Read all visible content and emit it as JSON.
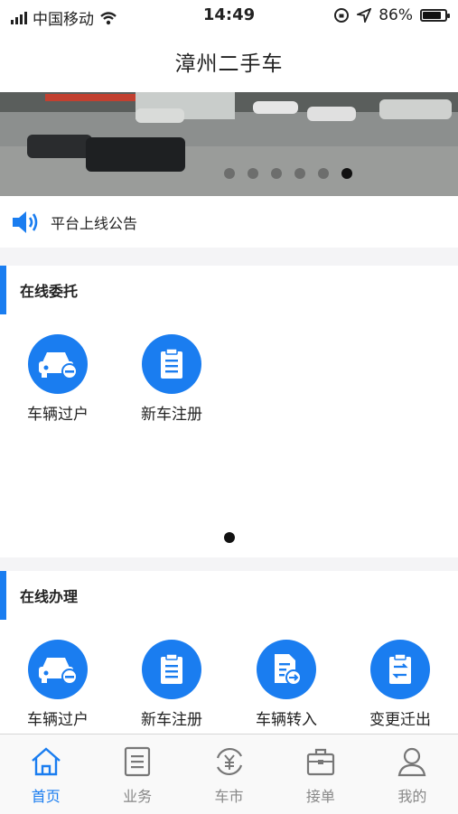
{
  "status_bar": {
    "carrier": "中国移动",
    "time": "14:49",
    "battery": "86%",
    "battery_level": 0.86
  },
  "header": {
    "title": "漳州二手车"
  },
  "banner": {
    "slide_count": 6,
    "active_slide": 6
  },
  "notice": {
    "text": "平台上线公告"
  },
  "online_entrust": {
    "title": "在线委托",
    "items": [
      {
        "label": "车辆过户",
        "icon": "car-transfer-icon"
      },
      {
        "label": "新车注册",
        "icon": "clipboard-icon"
      }
    ]
  },
  "online_handle": {
    "title": "在线办理",
    "items": [
      {
        "label": "车辆过户",
        "icon": "car-transfer-icon"
      },
      {
        "label": "新车注册",
        "icon": "clipboard-icon"
      },
      {
        "label": "车辆转入",
        "icon": "document-transfer-icon"
      },
      {
        "label": "变更迁出",
        "icon": "clipboard-exchange-icon"
      }
    ]
  },
  "tabbar": {
    "items": [
      {
        "label": "首页",
        "icon": "home-icon",
        "active": true
      },
      {
        "label": "业务",
        "icon": "business-icon",
        "active": false
      },
      {
        "label": "车市",
        "icon": "market-icon",
        "active": false
      },
      {
        "label": "接单",
        "icon": "briefcase-icon",
        "active": false
      },
      {
        "label": "我的",
        "icon": "user-icon",
        "active": false
      }
    ]
  },
  "colors": {
    "accent": "#1a7df0",
    "inactive_tab": "#888888",
    "text": "#222222"
  }
}
